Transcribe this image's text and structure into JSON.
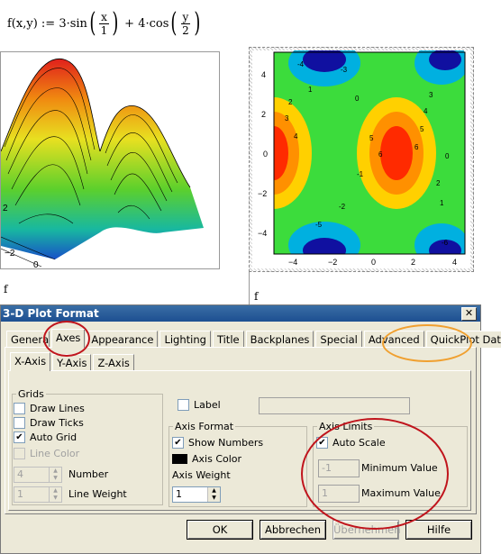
{
  "formula": {
    "lhs": "f(x,y) :=",
    "term1_coef": "3·sin",
    "term1_num": "x",
    "term1_den": "1",
    "plus": "+",
    "term2_coef": "4·cos",
    "term2_num": "y",
    "term2_den": "2"
  },
  "plot3d": {
    "axis_labels": [
      "2",
      "−2",
      "0"
    ],
    "caption": "f"
  },
  "contour": {
    "y_ticks": [
      "4",
      "2",
      "0",
      "−2",
      "−4"
    ],
    "x_ticks": [
      "−4",
      "−2",
      "0",
      "2",
      "4"
    ],
    "contour_labels": [
      "-4",
      "-3",
      "1",
      "0",
      "2",
      "3",
      "4",
      "5",
      "6",
      "-1",
      "-2",
      "-5",
      "-6",
      "6",
      "5",
      "4",
      "3",
      "2",
      "1",
      "0"
    ],
    "caption": "f",
    "colors": {
      "hot": "#ff2a00",
      "warm": "#ffd000",
      "mid": "#3cdc3c",
      "cool": "#00b0e0",
      "cold": "#1010a0"
    }
  },
  "dialog": {
    "title": "3-D Plot Format",
    "close_glyph": "✕",
    "tabs": [
      "General",
      "Axes",
      "Appearance",
      "Lighting",
      "Title",
      "Backplanes",
      "Special",
      "Advanced",
      "QuickPlot Data"
    ],
    "subtabs": [
      "X-Axis",
      "Y-Axis",
      "Z-Axis"
    ],
    "grids": {
      "legend": "Grids",
      "draw_lines": "Draw Lines",
      "draw_ticks": "Draw Ticks",
      "auto_grid": "Auto Grid",
      "line_color": "Line Color",
      "number_value": "4",
      "number_label": "Number",
      "line_weight_value": "1",
      "line_weight_label": "Line Weight"
    },
    "label_checkbox": "Label",
    "axis_format": {
      "legend": "Axis Format",
      "show_numbers": "Show Numbers",
      "axis_color": "Axis Color",
      "axis_weight_label": "Axis Weight",
      "axis_weight_value": "1"
    },
    "axis_limits": {
      "legend": "Axis Limits",
      "auto_scale": "Auto Scale",
      "min_value": "-1",
      "min_label": "Minimum Value",
      "max_value": "1",
      "max_label": "Maximum Value"
    },
    "buttons": {
      "ok": "OK",
      "cancel": "Abbrechen",
      "apply": "Übernehmen",
      "help": "Hilfe"
    }
  }
}
